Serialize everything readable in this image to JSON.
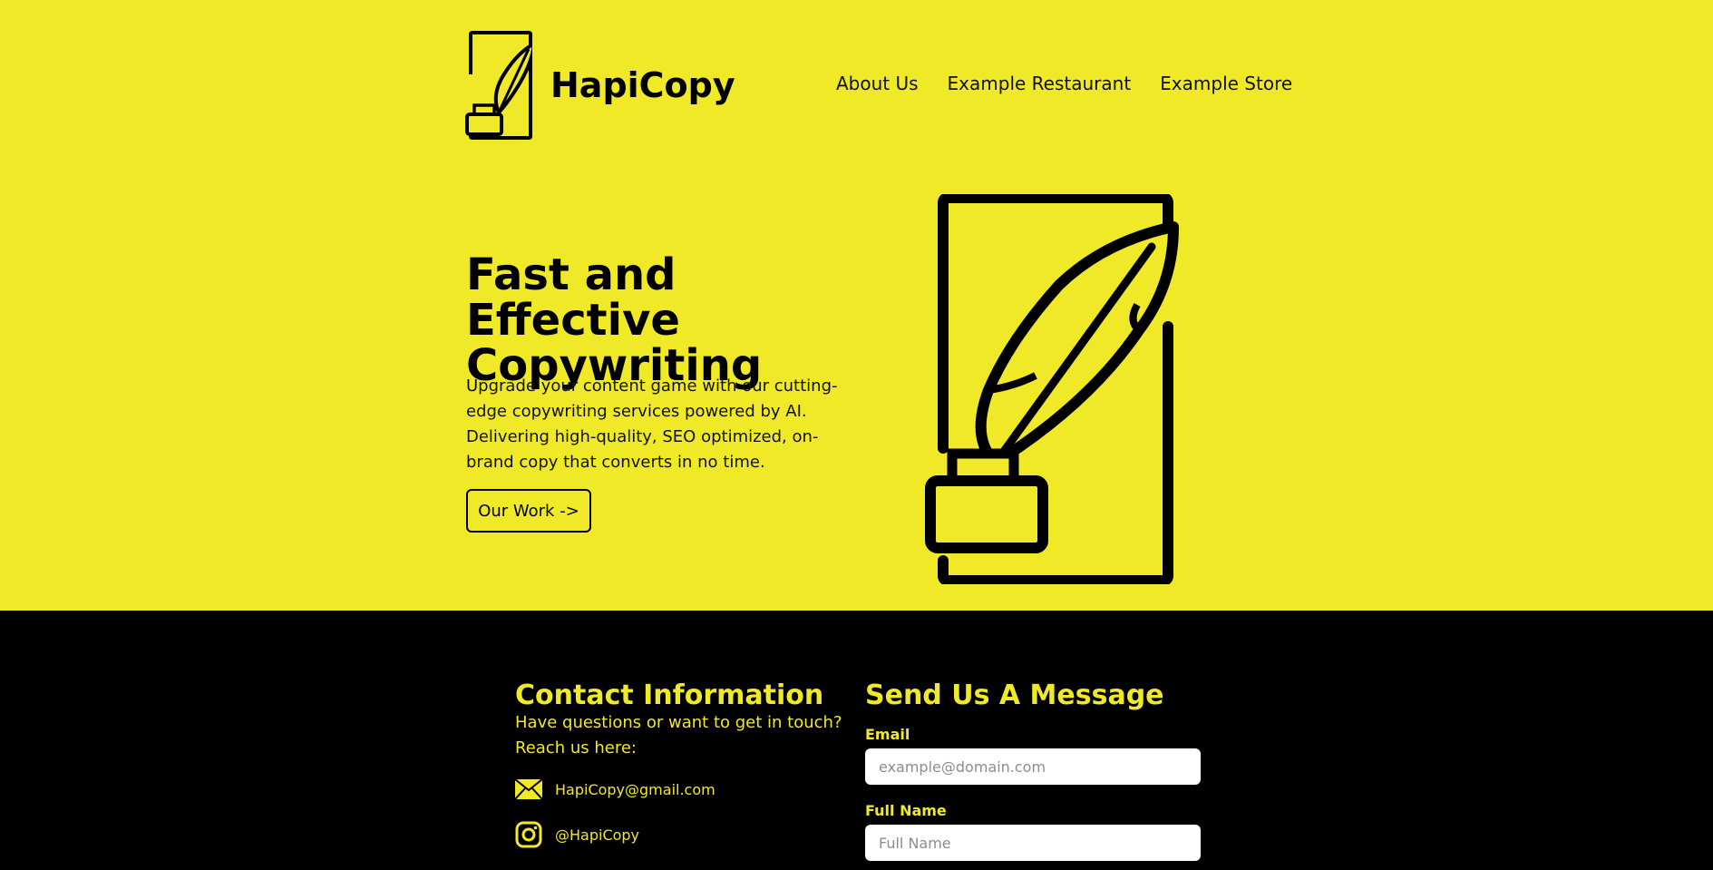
{
  "brand": {
    "name": "HapiCopy",
    "colors": {
      "accent": "#f0e927",
      "dark": "#000000",
      "input_bg": "#ffffff"
    }
  },
  "nav": {
    "items": [
      {
        "label": "About Us"
      },
      {
        "label": "Example Restaurant"
      },
      {
        "label": "Example Store"
      }
    ]
  },
  "hero": {
    "title": "Fast and Effective Copywriting",
    "description": "Upgrade your content game with our cutting-edge copywriting services powered by AI. Delivering high-quality, SEO optimized, on-brand copy that converts in no time.",
    "cta_label": "Our Work ->",
    "illustration_icon": "quill-and-inkwell-icon"
  },
  "contact": {
    "title": "Contact Information",
    "description": "Have questions or want to get in touch? Reach us here:",
    "email": "HapiCopy@gmail.com",
    "email_icon": "envelope-icon",
    "instagram": "@HapiCopy",
    "instagram_icon": "instagram-icon"
  },
  "message_form": {
    "title": "Send Us A Message",
    "email_label": "Email",
    "email_placeholder": "example@domain.com",
    "email_value": "",
    "name_label": "Full Name",
    "name_placeholder": "Full Name",
    "name_value": ""
  }
}
